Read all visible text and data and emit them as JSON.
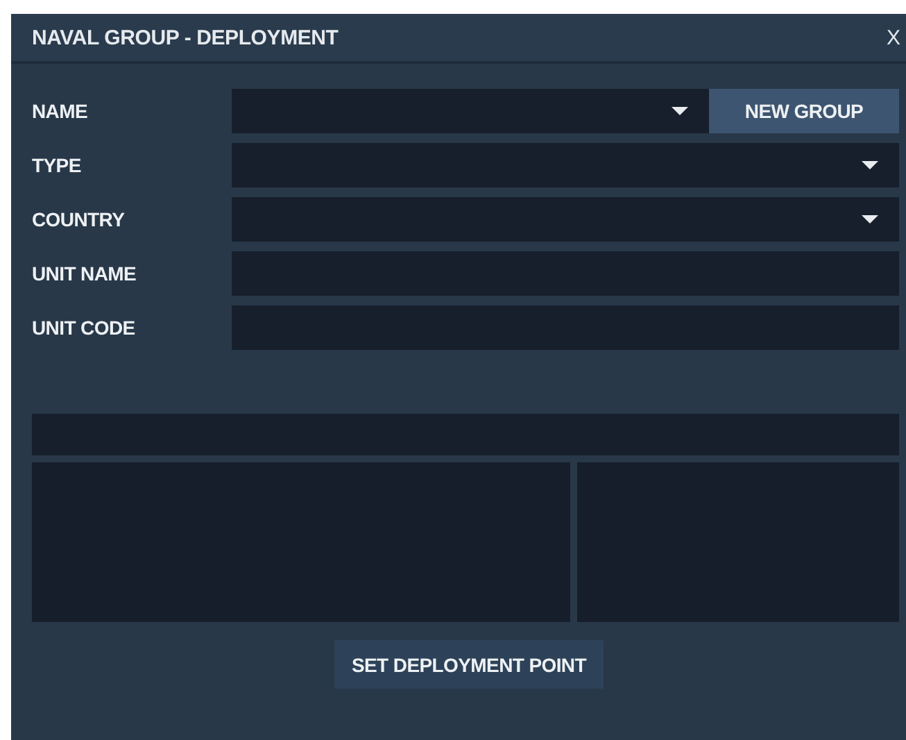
{
  "window": {
    "title": "NAVAL GROUP - DEPLOYMENT",
    "close": "X"
  },
  "fields": [
    {
      "label": "NAME",
      "kind": "dropdown",
      "button": "NEW GROUP"
    },
    {
      "label": "TYPE",
      "kind": "dropdown"
    },
    {
      "label": "COUNTRY",
      "kind": "dropdown"
    },
    {
      "label": "UNIT NAME",
      "kind": "text"
    },
    {
      "label": "UNIT CODE",
      "kind": "text"
    }
  ],
  "actions": [
    "SET DEPLOYMENT POINT"
  ]
}
